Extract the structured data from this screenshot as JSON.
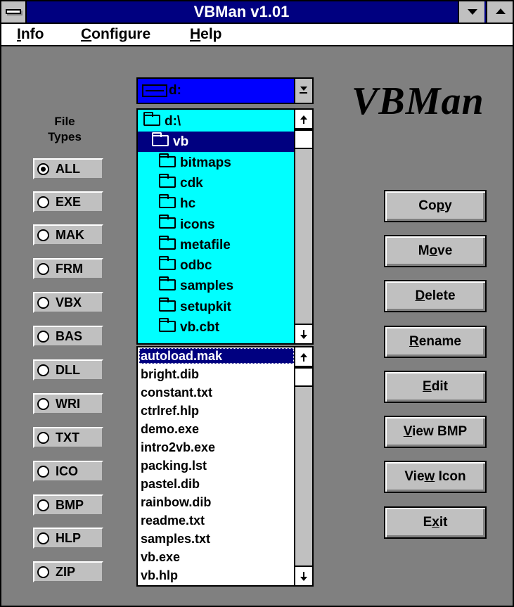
{
  "window": {
    "title": "VBMan v1.01",
    "logo_text": "VBMan"
  },
  "menu": [
    {
      "pre": "",
      "u": "I",
      "post": "nfo"
    },
    {
      "pre": "",
      "u": "C",
      "post": "onfigure"
    },
    {
      "pre": "",
      "u": "H",
      "post": "elp"
    }
  ],
  "file_types": {
    "label_line1": "File",
    "label_line2": "Types",
    "options": [
      "ALL",
      "EXE",
      "MAK",
      "FRM",
      "VBX",
      "BAS",
      "DLL",
      "WRI",
      "TXT",
      "ICO",
      "BMP",
      "HLP",
      "ZIP"
    ],
    "selected": "ALL"
  },
  "drive": {
    "value": "d:"
  },
  "directories": [
    {
      "name": "d:\\",
      "level": 0,
      "open": true,
      "selected": false
    },
    {
      "name": "vb",
      "level": 1,
      "open": true,
      "selected": true
    },
    {
      "name": "bitmaps",
      "level": 2,
      "open": false,
      "selected": false
    },
    {
      "name": "cdk",
      "level": 2,
      "open": false,
      "selected": false
    },
    {
      "name": "hc",
      "level": 2,
      "open": false,
      "selected": false
    },
    {
      "name": "icons",
      "level": 2,
      "open": false,
      "selected": false
    },
    {
      "name": "metafile",
      "level": 2,
      "open": false,
      "selected": false
    },
    {
      "name": "odbc",
      "level": 2,
      "open": false,
      "selected": false
    },
    {
      "name": "samples",
      "level": 2,
      "open": false,
      "selected": false
    },
    {
      "name": "setupkit",
      "level": 2,
      "open": false,
      "selected": false
    },
    {
      "name": "vb.cbt",
      "level": 2,
      "open": false,
      "selected": false
    }
  ],
  "files": [
    "autoload.mak",
    "bright.dib",
    "constant.txt",
    "ctrlref.hlp",
    "demo.exe",
    "intro2vb.exe",
    "packing.lst",
    "pastel.dib",
    "rainbow.dib",
    "readme.txt",
    "samples.txt",
    "vb.exe",
    "vb.hlp"
  ],
  "selected_file": "autoload.mak",
  "buttons": [
    {
      "pre": "Co",
      "u": "p",
      "post": "y"
    },
    {
      "pre": "M",
      "u": "o",
      "post": "ve"
    },
    {
      "pre": "",
      "u": "D",
      "post": "elete"
    },
    {
      "pre": "",
      "u": "R",
      "post": "ename"
    },
    {
      "pre": "",
      "u": "E",
      "post": "dit"
    },
    {
      "pre": "",
      "u": "V",
      "post": "iew BMP"
    },
    {
      "pre": "Vie",
      "u": "w",
      "post": " Icon"
    },
    {
      "pre": "E",
      "u": "x",
      "post": "it"
    }
  ],
  "colors": {
    "titlebar": "#000080",
    "workspace": "#808080",
    "directory_bg": "#00ffff",
    "drive_bg": "#0000ff",
    "selection": "#000080",
    "button_face": "#c0c0c0"
  }
}
